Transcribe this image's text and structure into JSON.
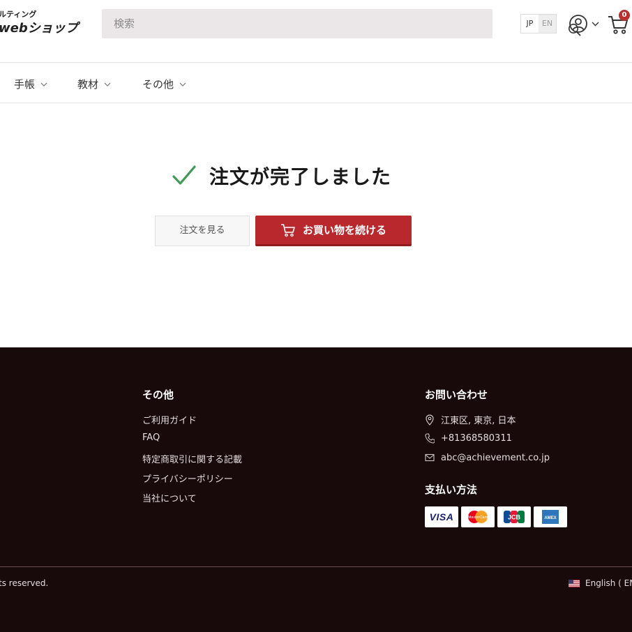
{
  "header": {
    "logo_top": "ルティング",
    "logo_main": "webショップ",
    "search": {
      "placeholder": "検索"
    },
    "lang": {
      "jp": "JP",
      "en": "EN",
      "active": "JP"
    },
    "cart_count": "0"
  },
  "nav": {
    "items": [
      {
        "label": "手帳"
      },
      {
        "label": "教材"
      },
      {
        "label": "その他"
      }
    ]
  },
  "main": {
    "title": "注文が完了しました",
    "view_order_label": "注文を見る",
    "continue_label": "お買い物を続ける"
  },
  "footer": {
    "other": {
      "heading": "その他",
      "links": [
        "ご利用ガイド",
        "FAQ",
        "特定商取引に関する記載",
        "プライバシーポリシー",
        "当社について"
      ]
    },
    "contact": {
      "heading": "お問い合わせ",
      "address": "江東区, 東京, 日本",
      "phone": "+81368580311",
      "email": "abc@achievement.co.jp"
    },
    "payment": {
      "heading": "支払い方法",
      "cards": [
        "VISA",
        "MasterCard",
        "JCB",
        "AMEX"
      ]
    },
    "copyright": "ts reserved.",
    "language": "English ( EN"
  },
  "colors": {
    "accent": "#b8282c",
    "footer_bg": "#180a0b",
    "success": "#3f9a55"
  }
}
